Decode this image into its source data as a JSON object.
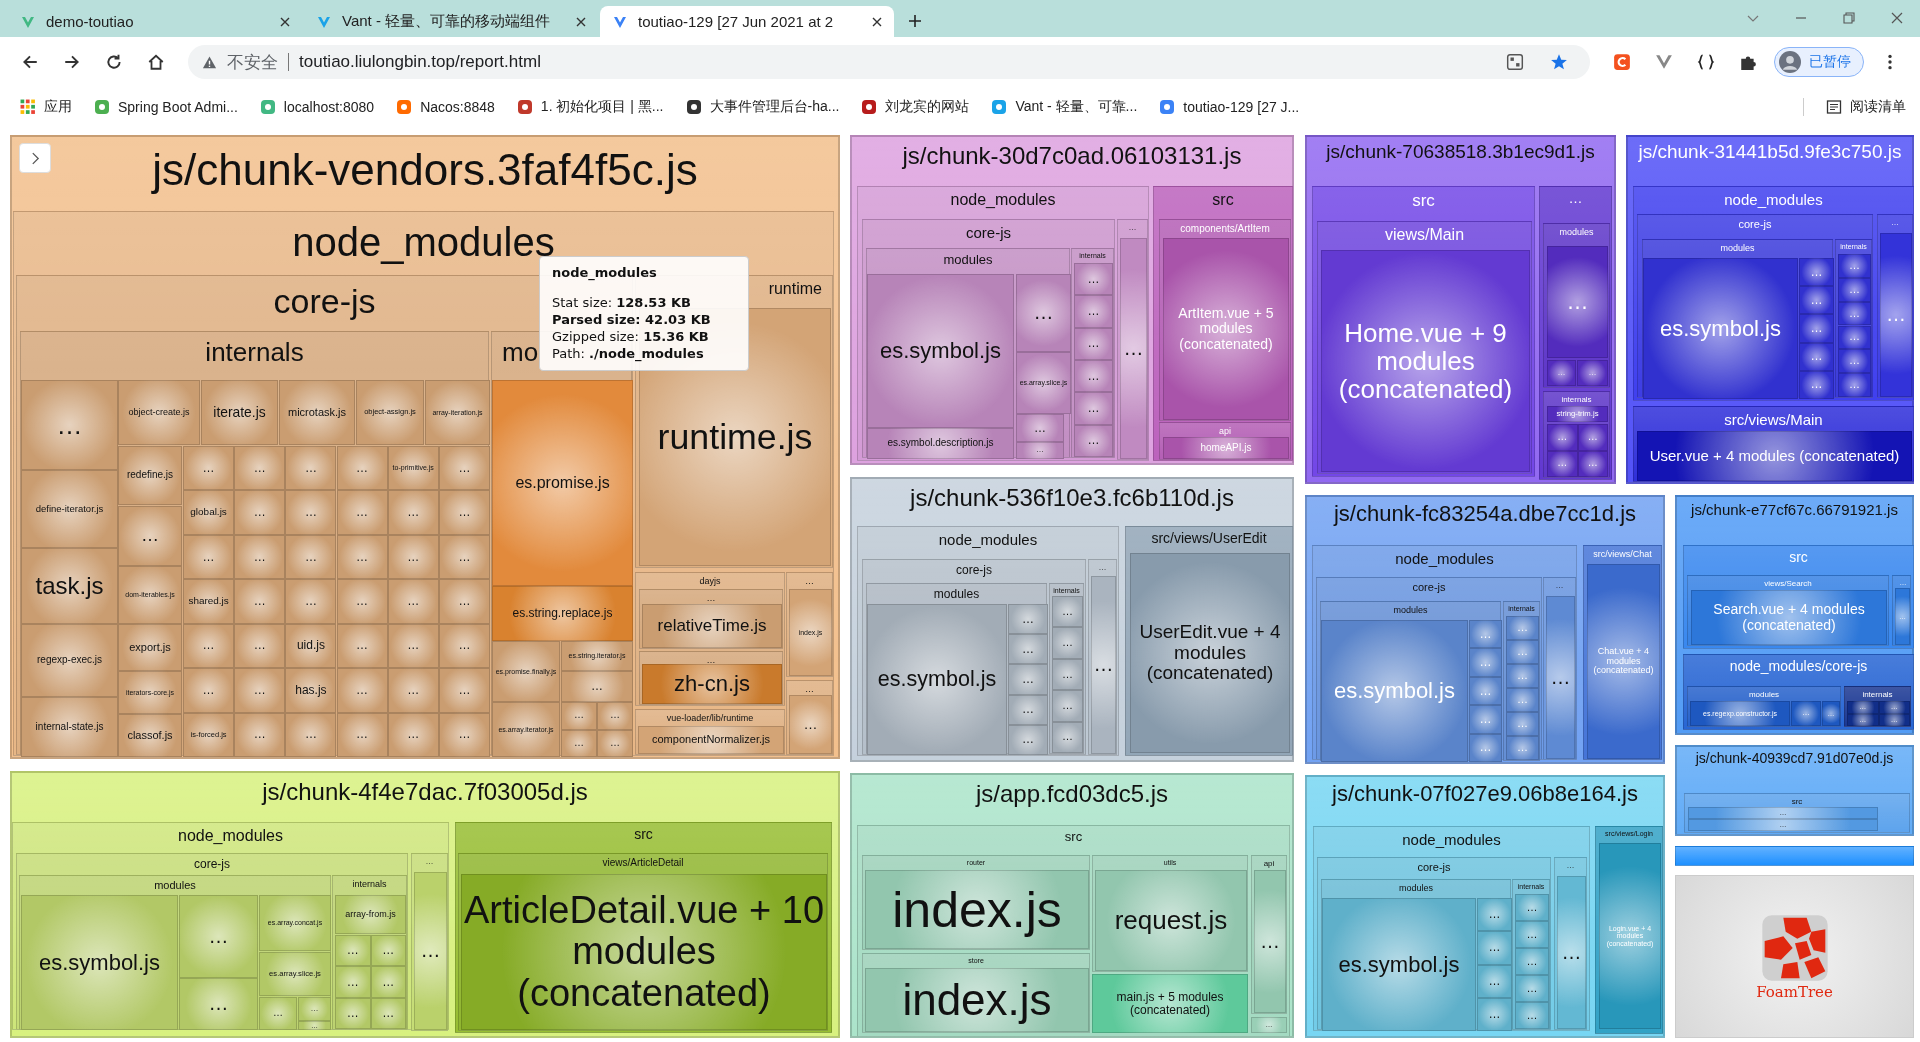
{
  "browser": {
    "tabs": [
      {
        "title": "demo-toutiao",
        "selected": false
      },
      {
        "title": "Vant - 轻量、可靠的移动端组件",
        "selected": false
      },
      {
        "title": "toutiao-129 [27 Jun 2021 at 2",
        "selected": true
      }
    ],
    "address": {
      "security": "不安全",
      "url": "toutiao.liulongbin.top/report.html"
    },
    "profile": "已暂停",
    "bookmarks": [
      "应用",
      "Spring Boot Admi...",
      "localhost:8080",
      "Nacos:8848",
      "1. 初始化项目 | 黑...",
      "大事件管理后台-ha...",
      "刘龙宾的网站",
      "Vant - 轻量、可靠...",
      "toutiao-129 [27 J..."
    ],
    "reading_list": "阅读清单"
  },
  "treemap": {
    "chunks": [
      {
        "label": "js/chunk-vendors.3faf4f5c.js",
        "color": "#f2bd88",
        "children": [
          {
            "label": "node_modules",
            "children": [
              {
                "label": "core-js",
                "children": [
                  {
                    "label": "internals",
                    "children": [
                      {
                        "label": "…"
                      },
                      {
                        "label": "define-iterator.js"
                      },
                      {
                        "label": "task.js"
                      },
                      {
                        "label": "regexp-exec.js"
                      },
                      {
                        "label": "internal-state.js"
                      },
                      {
                        "label": "object-create.js"
                      },
                      {
                        "label": "iterate.js"
                      },
                      {
                        "label": "microtask.js"
                      },
                      {
                        "label": "object-assign.js"
                      },
                      {
                        "label": "array-iteration.js"
                      },
                      {
                        "label": "redefine.js"
                      },
                      {
                        "label": "…"
                      },
                      {
                        "label": "dom-iterables.js"
                      },
                      {
                        "label": "export.js"
                      },
                      {
                        "label": "iterators-core.js"
                      },
                      {
                        "label": "classof.js"
                      },
                      {
                        "label": "…"
                      },
                      {
                        "label": "…"
                      },
                      {
                        "label": "…"
                      },
                      {
                        "label": "…"
                      },
                      {
                        "label": "to-primitive.js"
                      },
                      {
                        "label": "…"
                      },
                      {
                        "label": "global.js"
                      },
                      {
                        "label": "…"
                      },
                      {
                        "label": "…"
                      },
                      {
                        "label": "…"
                      },
                      {
                        "label": "…"
                      },
                      {
                        "label": "…"
                      },
                      {
                        "label": "…"
                      },
                      {
                        "label": "…"
                      },
                      {
                        "label": "…"
                      },
                      {
                        "label": "…"
                      },
                      {
                        "label": "…"
                      },
                      {
                        "label": "…"
                      },
                      {
                        "label": "shared.js"
                      },
                      {
                        "label": "…"
                      },
                      {
                        "label": "…"
                      },
                      {
                        "label": "…"
                      },
                      {
                        "label": "…"
                      },
                      {
                        "label": "…"
                      },
                      {
                        "label": "…"
                      },
                      {
                        "label": "…"
                      },
                      {
                        "label": "uid.js"
                      },
                      {
                        "label": "…"
                      },
                      {
                        "label": "…"
                      },
                      {
                        "label": "…"
                      },
                      {
                        "label": "…"
                      },
                      {
                        "label": "…"
                      },
                      {
                        "label": "has.js"
                      },
                      {
                        "label": "…"
                      },
                      {
                        "label": "…"
                      },
                      {
                        "label": "…"
                      },
                      {
                        "label": "is-forced.js"
                      },
                      {
                        "label": "…"
                      },
                      {
                        "label": "…"
                      },
                      {
                        "label": "…"
                      },
                      {
                        "label": "…"
                      },
                      {
                        "label": "…"
                      }
                    ]
                  },
                  {
                    "label": "mo",
                    "children": [
                      {
                        "label": "es.promise.js",
                        "color": "#e28a3c"
                      },
                      {
                        "label": "es.string.replace.js",
                        "color": "#d9822f"
                      },
                      {
                        "label": "es.promise.finally.js"
                      },
                      {
                        "label": "es.string.iterator.js"
                      },
                      {
                        "label": "…"
                      },
                      {
                        "label": "es.array.iterator.js"
                      },
                      {
                        "label": "…"
                      },
                      {
                        "label": "…"
                      },
                      {
                        "label": "…"
                      },
                      {
                        "label": "…"
                      }
                    ]
                  }
                ]
              },
              {
                "label": "runtime",
                "children": [
                  {
                    "label": "runtime.js"
                  }
                ]
              },
              {
                "label": "dayjs",
                "children": [
                  {
                    "label": "…",
                    "children": [
                      {
                        "label": "relativeTime.js"
                      }
                    ]
                  },
                  {
                    "label": "…",
                    "children": [
                      {
                        "label": "zh-cn.js",
                        "color": "#c97a2c"
                      }
                    ]
                  }
                ]
              },
              {
                "label": "vue-loader/lib/runtime",
                "children": [
                  {
                    "label": "componentNormalizer.js"
                  }
                ]
              },
              {
                "label": "…",
                "children": [
                  {
                    "label": "index.js"
                  }
                ]
              },
              {
                "label": "…",
                "children": [
                  {
                    "label": "…"
                  }
                ]
              }
            ]
          }
        ]
      },
      {
        "label": "js/chunk-4f4e7dac.7f03005d.js",
        "color": "#d6f07a",
        "children": [
          {
            "label": "node_modules",
            "children": [
              {
                "label": "core-js",
                "children": [
                  {
                    "label": "modules",
                    "children": [
                      {
                        "label": "es.symbol.js"
                      },
                      {
                        "label": "…"
                      },
                      {
                        "label": "…"
                      },
                      {
                        "label": "es.array.concat.js"
                      },
                      {
                        "label": "es.array.slice.js"
                      },
                      {
                        "label": "…"
                      },
                      {
                        "label": "…"
                      },
                      {
                        "label": "…"
                      }
                    ]
                  },
                  {
                    "label": "internals",
                    "children": [
                      {
                        "label": "array-from.js"
                      },
                      {
                        "label": "…"
                      },
                      {
                        "label": "…"
                      },
                      {
                        "label": "…"
                      },
                      {
                        "label": "…"
                      },
                      {
                        "label": "…"
                      },
                      {
                        "label": "…"
                      }
                    ]
                  }
                ]
              },
              {
                "label": "…",
                "children": [
                  {
                    "label": "…"
                  }
                ]
              }
            ]
          },
          {
            "label": "src",
            "color": "#93bb2a",
            "children": [
              {
                "label": "views/ArticleDetail",
                "children": [
                  {
                    "label": "ArticleDetail.vue + 10 modules (concatenated)"
                  }
                ]
              }
            ]
          }
        ]
      },
      {
        "label": "js/chunk-30d7c0ad.06103131.js",
        "color": "#dc9ede",
        "children": [
          {
            "label": "node_modules",
            "children": [
              {
                "label": "core-js",
                "children": [
                  {
                    "label": "modules",
                    "children": [
                      {
                        "label": "es.symbol.js"
                      },
                      {
                        "label": "es.symbol.description.js"
                      },
                      {
                        "label": "…"
                      },
                      {
                        "label": "es.array.slice.js"
                      },
                      {
                        "label": "…"
                      },
                      {
                        "label": "…"
                      }
                    ]
                  },
                  {
                    "label": "internals",
                    "children": [
                      {
                        "label": "…"
                      },
                      {
                        "label": "…"
                      },
                      {
                        "label": "…"
                      },
                      {
                        "label": "…"
                      },
                      {
                        "label": "…"
                      },
                      {
                        "label": "…"
                      }
                    ]
                  }
                ]
              },
              {
                "label": "…",
                "children": [
                  {
                    "label": "…"
                  }
                ]
              }
            ]
          },
          {
            "label": "src",
            "color": "#b95cba",
            "children": [
              {
                "label": "components/ArtItem",
                "children": [
                  {
                    "label": "ArtItem.vue + 5 modules (concatenated)"
                  }
                ]
              },
              {
                "label": "api",
                "children": [
                  {
                    "label": "homeAPI.js"
                  }
                ]
              }
            ]
          }
        ]
      },
      {
        "label": "js/chunk-536f10e3.fc6b110d.js",
        "color": "#c3cfdb",
        "children": [
          {
            "label": "node_modules",
            "children": [
              {
                "label": "core-js",
                "children": [
                  {
                    "label": "modules",
                    "children": [
                      {
                        "label": "es.symbol.js"
                      },
                      {
                        "label": "…"
                      },
                      {
                        "label": "…"
                      },
                      {
                        "label": "…"
                      },
                      {
                        "label": "…"
                      },
                      {
                        "label": "…"
                      }
                    ]
                  },
                  {
                    "label": "internals",
                    "children": [
                      {
                        "label": "…"
                      },
                      {
                        "label": "…"
                      },
                      {
                        "label": "…"
                      },
                      {
                        "label": "…"
                      },
                      {
                        "label": "…"
                      }
                    ]
                  }
                ]
              },
              {
                "label": "…",
                "children": [
                  {
                    "label": "…"
                  }
                ]
              }
            ]
          },
          {
            "label": "src/views/UserEdit",
            "color": "#8ea2b4",
            "children": [
              {
                "label": "UserEdit.vue + 4 modules (concatenated)"
              }
            ]
          }
        ]
      },
      {
        "label": "js/app.fcd03dc5.js",
        "color": "#a8e3c8",
        "children": [
          {
            "label": "src",
            "children": [
              {
                "label": "router",
                "children": [
                  {
                    "label": "index.js"
                  }
                ]
              },
              {
                "label": "store",
                "children": [
                  {
                    "label": "index.js"
                  }
                ]
              },
              {
                "label": "utils",
                "children": [
                  {
                    "label": "request.js"
                  }
                ]
              },
              {
                "label": "main.js + 5 modules (concatenated)",
                "color": "#5ec99b"
              },
              {
                "label": "api",
                "children": [
                  {
                    "label": "…"
                  }
                ]
              },
              {
                "label": "…"
              }
            ]
          }
        ]
      },
      {
        "label": "js/chunk-70638518.3b1ec9d1.js",
        "color": "#8d63f0",
        "children": [
          {
            "label": "src",
            "color": "#6d40e6",
            "children": [
              {
                "label": "views/Main",
                "children": [
                  {
                    "label": "Home.vue + 9 modules (concatenated)"
                  }
                ]
              }
            ]
          },
          {
            "label": "…",
            "color": "#5b30cf",
            "children": [
              {
                "label": "modules",
                "children": [
                  {
                    "label": "…"
                  },
                  {
                    "label": "…"
                  },
                  {
                    "label": "…"
                  }
                ]
              },
              {
                "label": "internals",
                "children": [
                  {
                    "label": "string-trim.js"
                  },
                  {
                    "label": "…"
                  },
                  {
                    "label": "…"
                  },
                  {
                    "label": "…"
                  },
                  {
                    "label": "…"
                  }
                ]
              }
            ]
          }
        ]
      },
      {
        "label": "js/chunk-31441b5d.9fe3c750.js",
        "color": "#4c4cf7",
        "children": [
          {
            "label": "node_modules",
            "color": "#3838ee",
            "children": [
              {
                "label": "core-js",
                "children": [
                  {
                    "label": "modules",
                    "children": [
                      {
                        "label": "es.symbol.js"
                      },
                      {
                        "label": "…"
                      },
                      {
                        "label": "…"
                      },
                      {
                        "label": "…"
                      },
                      {
                        "label": "…"
                      },
                      {
                        "label": "…"
                      }
                    ]
                  },
                  {
                    "label": "internals",
                    "children": [
                      {
                        "label": "…"
                      },
                      {
                        "label": "…"
                      },
                      {
                        "label": "…"
                      },
                      {
                        "label": "…"
                      },
                      {
                        "label": "…"
                      },
                      {
                        "label": "…"
                      }
                    ]
                  }
                ]
              },
              {
                "label": "…",
                "children": [
                  {
                    "label": "…"
                  }
                ]
              }
            ]
          },
          {
            "label": "src/views/Main",
            "color": "#2727d8",
            "children": [
              {
                "label": "User.vue + 4 modules (concatenated)",
                "color": "#1414b4"
              }
            ]
          }
        ]
      },
      {
        "label": "js/chunk-fc83254a.dbe7cc1d.js",
        "color": "#6c9ef2",
        "children": [
          {
            "label": "node_modules",
            "children": [
              {
                "label": "core-js",
                "children": [
                  {
                    "label": "modules",
                    "children": [
                      {
                        "label": "es.symbol.js"
                      },
                      {
                        "label": "…"
                      },
                      {
                        "label": "…"
                      },
                      {
                        "label": "…"
                      },
                      {
                        "label": "…"
                      },
                      {
                        "label": "…"
                      }
                    ]
                  },
                  {
                    "label": "internals",
                    "children": [
                      {
                        "label": "…"
                      },
                      {
                        "label": "…"
                      },
                      {
                        "label": "…"
                      },
                      {
                        "label": "…"
                      },
                      {
                        "label": "…"
                      },
                      {
                        "label": "…"
                      }
                    ]
                  }
                ]
              },
              {
                "label": "…",
                "children": [
                  {
                    "label": "…"
                  }
                ]
              }
            ]
          },
          {
            "label": "src/views/Chat",
            "color": "#3e6fd6",
            "children": [
              {
                "label": "Chat.vue + 4 modules (concatenated)"
              }
            ]
          }
        ]
      },
      {
        "label": "js/chunk-e77cf67c.66791921.js",
        "color": "#4c98f5",
        "children": [
          {
            "label": "src",
            "color": "#3183ee",
            "children": [
              {
                "label": "views/Search",
                "children": [
                  {
                    "label": "Search.vue + 4 modules (concatenated)"
                  }
                ]
              },
              {
                "label": "…",
                "children": [
                  {
                    "label": "…"
                  }
                ]
              }
            ]
          },
          {
            "label": "node_modules/core-js",
            "color": "#2060d2",
            "children": [
              {
                "label": "modules",
                "children": [
                  {
                    "label": "es.regexp.constructor.js"
                  },
                  {
                    "label": "…"
                  },
                  {
                    "label": "…"
                  }
                ]
              },
              {
                "label": "internals",
                "color": "#12308f",
                "children": [
                  {
                    "label": "…"
                  },
                  {
                    "label": "…"
                  },
                  {
                    "label": "…"
                  },
                  {
                    "label": "…"
                  }
                ]
              }
            ]
          }
        ]
      },
      {
        "label": "js/chunk-07f027e9.06b8e164.js",
        "color": "#72d4f2",
        "children": [
          {
            "label": "node_modules",
            "children": [
              {
                "label": "core-js",
                "children": [
                  {
                    "label": "modules",
                    "children": [
                      {
                        "label": "es.symbol.js"
                      },
                      {
                        "label": "…"
                      },
                      {
                        "label": "…"
                      },
                      {
                        "label": "…"
                      },
                      {
                        "label": "…"
                      }
                    ]
                  },
                  {
                    "label": "internals",
                    "children": [
                      {
                        "label": "…"
                      },
                      {
                        "label": "…"
                      },
                      {
                        "label": "…"
                      },
                      {
                        "label": "…"
                      },
                      {
                        "label": "…"
                      }
                    ]
                  }
                ]
              },
              {
                "label": "…",
                "children": [
                  {
                    "label": "…"
                  }
                ]
              }
            ]
          },
          {
            "label": "src/views/Login",
            "color": "#2a9ec3",
            "children": [
              {
                "label": "Login.vue + 4 modules (concatenated)"
              }
            ]
          }
        ]
      },
      {
        "label": "js/chunk-40939cd7.91d07e0d.js",
        "color": "#5ba8f7",
        "children": [
          {
            "label": "src",
            "children": [
              {
                "label": "…"
              },
              {
                "label": "…"
              }
            ]
          }
        ]
      }
    ],
    "tooltip": {
      "title": "node_modules",
      "lines": [
        "Stat size: **128.53 KB**",
        "**Parsed size: 42.03 KB**",
        "Gzipped size: **15.36 KB**",
        "Path: **./node_modules**"
      ]
    }
  },
  "logo": {
    "text": "FoamTree"
  }
}
